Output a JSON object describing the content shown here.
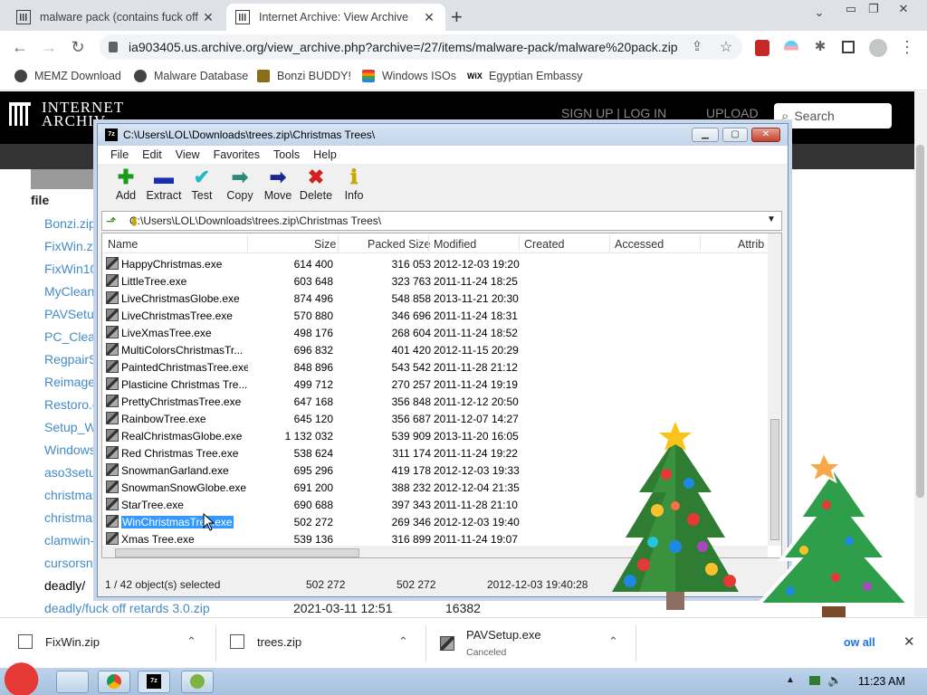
{
  "browser": {
    "tabs": [
      {
        "title": "malware pack (contains fuck off t"
      },
      {
        "title": "Internet Archive: View Archive"
      }
    ],
    "url": "ia903405.us.archive.org/view_archive.php?archive=/27/items/malware-pack/malware%20pack.zip",
    "bookmarks": [
      "MEMZ Download",
      "Malware Database",
      "Bonzi BUDDY!",
      "Windows ISOs",
      "Egyptian Embassy"
    ]
  },
  "archive_page": {
    "logo_line1": "INTERNET",
    "logo_line2": "ARCHIV",
    "header_right": "SIGN UP | LOG IN",
    "upload": "UPLOAD",
    "search_placeholder": "Search",
    "file_header": "file",
    "files": [
      "Bonzi.zip",
      "FixWin.zi",
      "FixWin10",
      "MyCleanl",
      "PAVSetup",
      "PC_Clea",
      "RegpairS",
      "Reimage",
      "Restoro.e",
      "Setup_W",
      "Windows",
      "aso3setu",
      "christmas",
      "christmas",
      "clamwin-",
      "cursorsnc"
    ],
    "dir_row": "deadly/",
    "last_row": {
      "name": "deadly/fuck off retards 3.0.zip",
      "date": "2021-03-11 12:51",
      "size": "16382"
    }
  },
  "zip_window": {
    "title": "C:\\Users\\LOL\\Downloads\\trees.zip\\Christmas Trees\\",
    "menu": [
      "File",
      "Edit",
      "View",
      "Favorites",
      "Tools",
      "Help"
    ],
    "tools": [
      {
        "label": "Add",
        "glyph": "✚",
        "color": "#1a9a1a"
      },
      {
        "label": "Extract",
        "glyph": "▬",
        "color": "#1a2fb0"
      },
      {
        "label": "Test",
        "glyph": "✔",
        "color": "#22b8c8"
      },
      {
        "label": "Copy",
        "glyph": "➡",
        "color": "#2b8a7a"
      },
      {
        "label": "Move",
        "glyph": "➡",
        "color": "#1a2890"
      },
      {
        "label": "Delete",
        "glyph": "✖",
        "color": "#d42020"
      },
      {
        "label": "Info",
        "glyph": "ℹ",
        "color": "#c8a800"
      }
    ],
    "path": "C:\\Users\\LOL\\Downloads\\trees.zip\\Christmas Trees\\",
    "columns": [
      "Name",
      "Size",
      "Packed Size",
      "Modified",
      "Created",
      "Accessed",
      "Attrib"
    ],
    "rows": [
      {
        "name": "HappyChristmas.exe",
        "size": "614 400",
        "packed": "316 053",
        "modified": "2012-12-03 19:20"
      },
      {
        "name": "LittleTree.exe",
        "size": "603 648",
        "packed": "323 763",
        "modified": "2011-11-24 18:25"
      },
      {
        "name": "LiveChristmasGlobe.exe",
        "size": "874 496",
        "packed": "548 858",
        "modified": "2013-11-21 20:30"
      },
      {
        "name": "LiveChristmasTree.exe",
        "size": "570 880",
        "packed": "346 696",
        "modified": "2011-11-24 18:31"
      },
      {
        "name": "LiveXmasTree.exe",
        "size": "498 176",
        "packed": "268 604",
        "modified": "2011-11-24 18:52"
      },
      {
        "name": "MultiColorsChristmasTr...",
        "size": "696 832",
        "packed": "401 420",
        "modified": "2012-11-15 20:29"
      },
      {
        "name": "PaintedChristmasTree.exe",
        "size": "848 896",
        "packed": "543 542",
        "modified": "2011-11-28 21:12"
      },
      {
        "name": "Plasticine Christmas Tre...",
        "size": "499 712",
        "packed": "270 257",
        "modified": "2011-11-24 19:19"
      },
      {
        "name": "PrettyChristmasTree.exe",
        "size": "647 168",
        "packed": "356 848",
        "modified": "2011-12-12 20:50"
      },
      {
        "name": "RainbowTree.exe",
        "size": "645 120",
        "packed": "356 687",
        "modified": "2011-12-07 14:27"
      },
      {
        "name": "RealChristmasGlobe.exe",
        "size": "1 132 032",
        "packed": "539 909",
        "modified": "2013-11-20 16:05"
      },
      {
        "name": "Red Christmas Tree.exe",
        "size": "538 624",
        "packed": "311 174",
        "modified": "2011-11-24 19:22"
      },
      {
        "name": "SnowmanGarland.exe",
        "size": "695 296",
        "packed": "419 178",
        "modified": "2012-12-03 19:33"
      },
      {
        "name": "SnowmanSnowGlobe.exe",
        "size": "691 200",
        "packed": "388 232",
        "modified": "2012-12-04 21:35"
      },
      {
        "name": "StarTree.exe",
        "size": "690 688",
        "packed": "397 343",
        "modified": "2011-11-28 21:10"
      },
      {
        "name": "WinChristmasTree.exe",
        "size": "502 272",
        "packed": "269 346",
        "modified": "2012-12-03 19:40",
        "selected": true
      },
      {
        "name": "Xmas Tree.exe",
        "size": "539 136",
        "packed": "316 899",
        "modified": "2011-11-24 19:07"
      }
    ],
    "status": {
      "selected": "1 / 42 object(s) selected",
      "size": "502 272",
      "packed": "502 272",
      "modified": "2012-12-03 19:40:28"
    }
  },
  "downloads": [
    {
      "name": "FixWin.zip"
    },
    {
      "name": "trees.zip"
    },
    {
      "name": "PAVSetup.exe",
      "sub": "Canceled"
    }
  ],
  "downloads_show_all": "ow all",
  "taskbar": {
    "clock": "11:23 AM"
  }
}
